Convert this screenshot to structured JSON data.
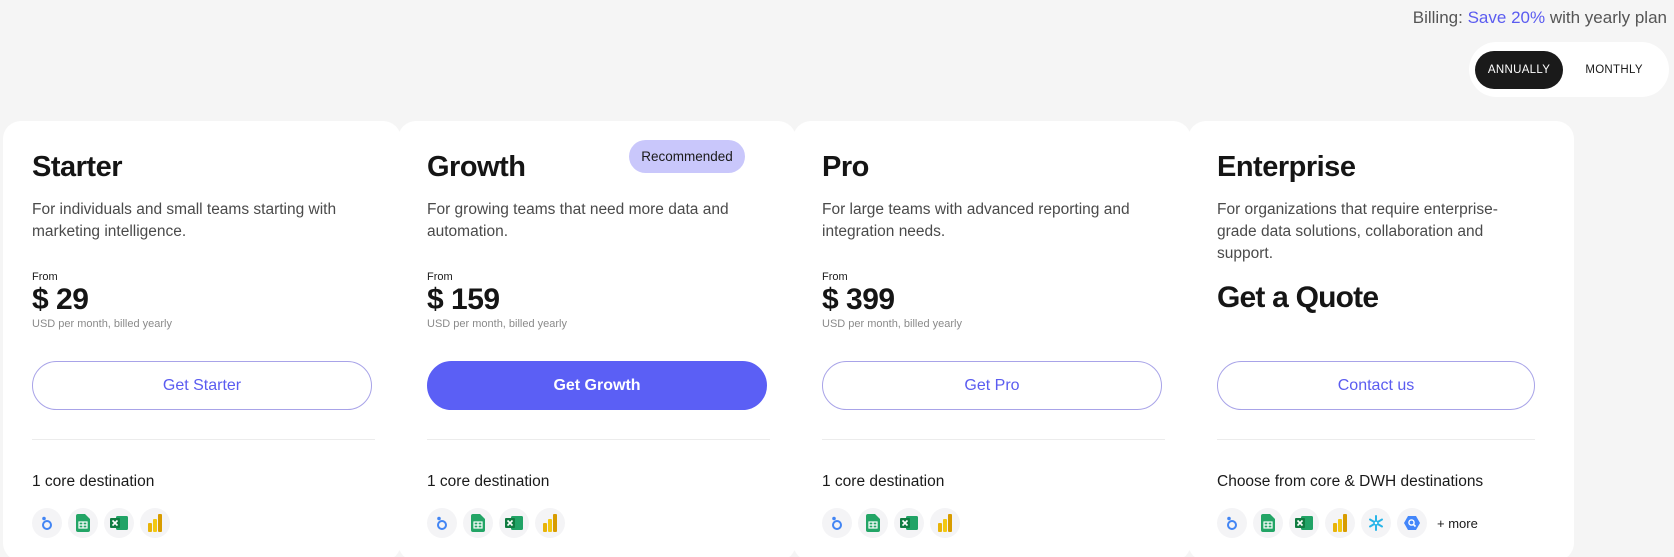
{
  "billing": {
    "prefix": "Billing:",
    "save": "Save 20%",
    "suffix": "with yearly plan",
    "options": [
      "ANNUALLY",
      "MONTHLY"
    ],
    "selected": "ANNUALLY"
  },
  "colors": {
    "accent": "#5b5cf0",
    "primary_button": "#5b5ff5",
    "badge": "#c9c7fb"
  },
  "plans": [
    {
      "title": "Starter",
      "description": "For individuals and small teams starting with marketing intelligence.",
      "from": "From",
      "price": "$ 29",
      "price_note": "USD per month, billed yearly",
      "cta": "Get Starter",
      "destinations": "1 core destination",
      "icons": [
        "looker-studio-icon",
        "google-sheets-icon",
        "excel-icon",
        "power-bi-icon"
      ]
    },
    {
      "title": "Growth",
      "badge": "Recommended",
      "description": "For growing teams that need more data and automation.",
      "from": "From",
      "price": "$ 159",
      "price_note": "USD per month, billed yearly",
      "cta": "Get Growth",
      "destinations": "1 core destination",
      "icons": [
        "looker-studio-icon",
        "google-sheets-icon",
        "excel-icon",
        "power-bi-icon"
      ]
    },
    {
      "title": "Pro",
      "description": "For large teams with advanced reporting and integration needs.",
      "from": "From",
      "price": "$ 399",
      "price_note": "USD per month, billed yearly",
      "cta": "Get Pro",
      "destinations": "1 core destination",
      "icons": [
        "looker-studio-icon",
        "google-sheets-icon",
        "excel-icon",
        "power-bi-icon"
      ]
    },
    {
      "title": "Enterprise",
      "description": "For organizations that require enterprise-grade data solutions, collaboration and support.",
      "quote": "Get a Quote",
      "cta": "Contact us",
      "destinations": "Choose from core & DWH destinations",
      "icons": [
        "looker-studio-icon",
        "google-sheets-icon",
        "excel-icon",
        "power-bi-icon",
        "snowflake-icon",
        "bigquery-icon"
      ],
      "more": "+ more"
    }
  ]
}
